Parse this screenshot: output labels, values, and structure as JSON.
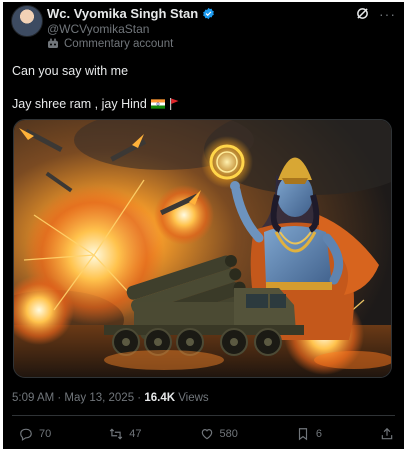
{
  "post": {
    "display_name": "Wc. Vyomika Singh Stan",
    "handle": "@WCVyomikaStan",
    "account_label": "Commentary account",
    "text_line1": "Can you say with me",
    "text_line2": "Jay shree ram , jay Hind",
    "timestamp": "5:09 AM · May 13, 2025 · ",
    "views_count": "16.4K",
    "views_label": " Views"
  },
  "actions": {
    "replies": "70",
    "reposts": "47",
    "likes": "580",
    "bookmarks": "6"
  },
  "colors": {
    "background": "#000000",
    "text": "#e7e9ea",
    "secondary": "#71767b",
    "verified": "#1d9bf0"
  },
  "icons": [
    "avatar",
    "verified-badge-icon",
    "commentary-icon",
    "grok-icon",
    "more-icon",
    "india-flag-icon",
    "red-flag-icon",
    "reply-icon",
    "repost-icon",
    "like-icon",
    "bookmark-icon",
    "share-icon"
  ]
}
